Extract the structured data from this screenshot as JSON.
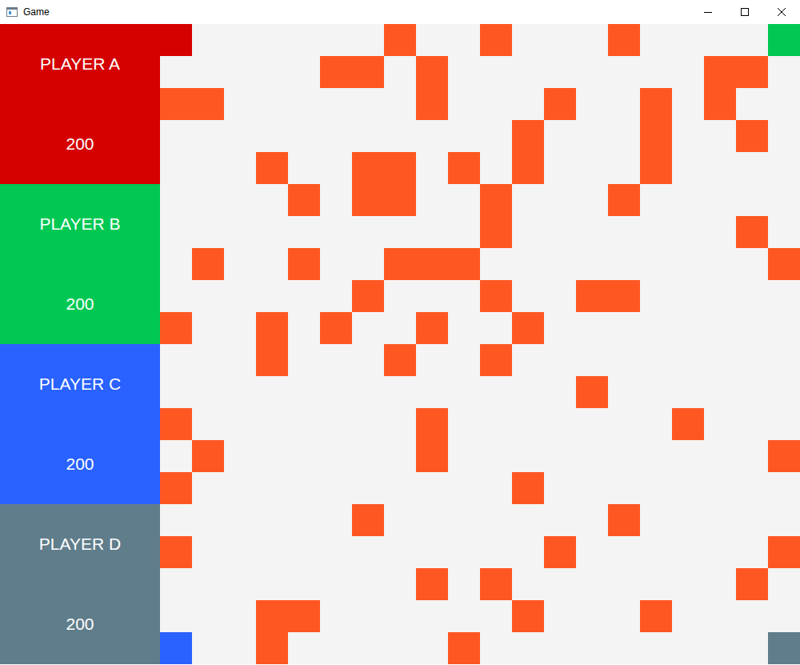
{
  "window": {
    "title": "Game"
  },
  "players": [
    {
      "name": "PLAYER A",
      "score": "200",
      "color": "#d50000",
      "token": "a"
    },
    {
      "name": "PLAYER B",
      "score": "200",
      "color": "#00c853",
      "token": "b"
    },
    {
      "name": "PLAYER C",
      "score": "200",
      "color": "#2962ff",
      "token": "c"
    },
    {
      "name": "PLAYER D",
      "score": "200",
      "color": "#607d8b",
      "token": "d"
    }
  ],
  "board": {
    "rows": [
      [
        "a",
        "empty",
        "empty",
        "empty",
        "empty",
        "empty",
        "empty",
        "block",
        "empty",
        "empty",
        "block",
        "empty",
        "empty",
        "empty",
        "block",
        "empty",
        "empty",
        "empty",
        "empty",
        "b"
      ],
      [
        "empty",
        "empty",
        "empty",
        "empty",
        "empty",
        "block",
        "block",
        "empty",
        "block",
        "empty",
        "empty",
        "empty",
        "empty",
        "empty",
        "empty",
        "empty",
        "empty",
        "block",
        "block",
        "empty"
      ],
      [
        "block",
        "block",
        "empty",
        "empty",
        "empty",
        "empty",
        "empty",
        "empty",
        "block",
        "empty",
        "empty",
        "empty",
        "block",
        "empty",
        "empty",
        "block",
        "empty",
        "block",
        "empty",
        "empty"
      ],
      [
        "empty",
        "empty",
        "empty",
        "empty",
        "empty",
        "empty",
        "empty",
        "empty",
        "empty",
        "empty",
        "empty",
        "block",
        "empty",
        "empty",
        "empty",
        "block",
        "empty",
        "empty",
        "block",
        "empty"
      ],
      [
        "empty",
        "empty",
        "empty",
        "block",
        "empty",
        "empty",
        "block",
        "block",
        "empty",
        "block",
        "empty",
        "block",
        "empty",
        "empty",
        "empty",
        "block",
        "empty",
        "empty",
        "empty",
        "empty"
      ],
      [
        "empty",
        "empty",
        "empty",
        "empty",
        "block",
        "empty",
        "block",
        "block",
        "empty",
        "empty",
        "block",
        "empty",
        "empty",
        "empty",
        "block",
        "empty",
        "empty",
        "empty",
        "empty",
        "empty"
      ],
      [
        "empty",
        "empty",
        "empty",
        "empty",
        "empty",
        "empty",
        "empty",
        "empty",
        "empty",
        "empty",
        "block",
        "empty",
        "empty",
        "empty",
        "empty",
        "empty",
        "empty",
        "empty",
        "block",
        "empty"
      ],
      [
        "empty",
        "block",
        "empty",
        "empty",
        "block",
        "empty",
        "empty",
        "block",
        "block",
        "block",
        "empty",
        "empty",
        "empty",
        "empty",
        "empty",
        "empty",
        "empty",
        "empty",
        "empty",
        "block"
      ],
      [
        "empty",
        "empty",
        "empty",
        "empty",
        "empty",
        "empty",
        "block",
        "empty",
        "empty",
        "empty",
        "block",
        "empty",
        "empty",
        "block",
        "block",
        "empty",
        "empty",
        "empty",
        "empty",
        "empty"
      ],
      [
        "block",
        "empty",
        "empty",
        "block",
        "empty",
        "block",
        "empty",
        "empty",
        "block",
        "empty",
        "empty",
        "block",
        "empty",
        "empty",
        "empty",
        "empty",
        "empty",
        "empty",
        "empty",
        "empty"
      ],
      [
        "empty",
        "empty",
        "empty",
        "block",
        "empty",
        "empty",
        "empty",
        "block",
        "empty",
        "empty",
        "block",
        "empty",
        "empty",
        "empty",
        "empty",
        "empty",
        "empty",
        "empty",
        "empty",
        "empty"
      ],
      [
        "empty",
        "empty",
        "empty",
        "empty",
        "empty",
        "empty",
        "empty",
        "empty",
        "empty",
        "empty",
        "empty",
        "empty",
        "empty",
        "block",
        "empty",
        "empty",
        "empty",
        "empty",
        "empty",
        "empty"
      ],
      [
        "block",
        "empty",
        "empty",
        "empty",
        "empty",
        "empty",
        "empty",
        "empty",
        "block",
        "empty",
        "empty",
        "empty",
        "empty",
        "empty",
        "empty",
        "empty",
        "block",
        "empty",
        "empty",
        "empty"
      ],
      [
        "empty",
        "block",
        "empty",
        "empty",
        "empty",
        "empty",
        "empty",
        "empty",
        "block",
        "empty",
        "empty",
        "empty",
        "empty",
        "empty",
        "empty",
        "empty",
        "empty",
        "empty",
        "empty",
        "block"
      ],
      [
        "block",
        "empty",
        "empty",
        "empty",
        "empty",
        "empty",
        "empty",
        "empty",
        "empty",
        "empty",
        "empty",
        "block",
        "empty",
        "empty",
        "empty",
        "empty",
        "empty",
        "empty",
        "empty",
        "empty"
      ],
      [
        "empty",
        "empty",
        "empty",
        "empty",
        "empty",
        "empty",
        "block",
        "empty",
        "empty",
        "empty",
        "empty",
        "empty",
        "empty",
        "empty",
        "block",
        "empty",
        "empty",
        "empty",
        "empty",
        "empty"
      ],
      [
        "block",
        "empty",
        "empty",
        "empty",
        "empty",
        "empty",
        "empty",
        "empty",
        "empty",
        "empty",
        "empty",
        "empty",
        "block",
        "empty",
        "empty",
        "empty",
        "empty",
        "empty",
        "empty",
        "block"
      ],
      [
        "empty",
        "empty",
        "empty",
        "empty",
        "empty",
        "empty",
        "empty",
        "empty",
        "block",
        "empty",
        "block",
        "empty",
        "empty",
        "empty",
        "empty",
        "empty",
        "empty",
        "empty",
        "block",
        "empty"
      ],
      [
        "empty",
        "empty",
        "empty",
        "block",
        "block",
        "empty",
        "empty",
        "empty",
        "empty",
        "empty",
        "empty",
        "block",
        "empty",
        "empty",
        "empty",
        "block",
        "empty",
        "empty",
        "empty",
        "empty"
      ],
      [
        "c",
        "empty",
        "empty",
        "block",
        "empty",
        "empty",
        "empty",
        "empty",
        "empty",
        "block",
        "empty",
        "empty",
        "empty",
        "empty",
        "empty",
        "empty",
        "empty",
        "empty",
        "empty",
        "d"
      ]
    ]
  }
}
